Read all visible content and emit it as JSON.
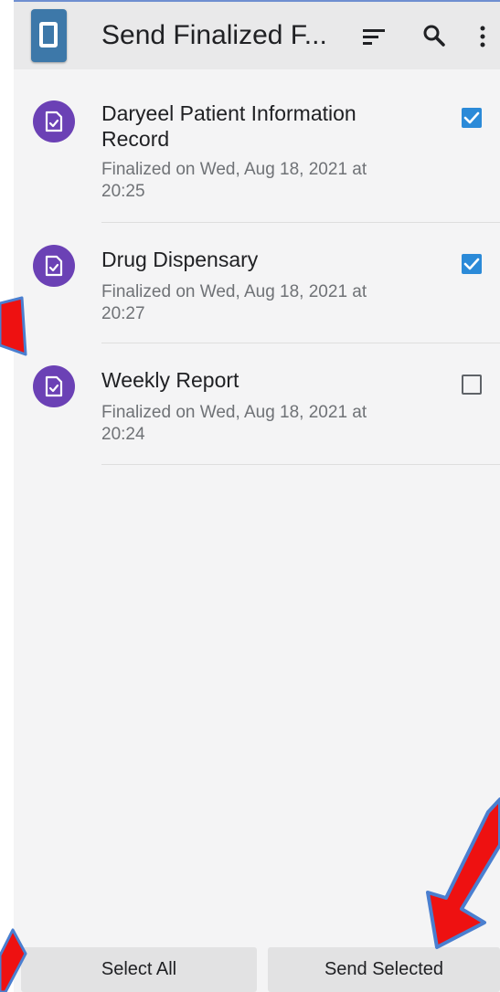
{
  "toolbar": {
    "title": "Send Finalized F...",
    "icons": [
      "app-logo-icon",
      "sort-icon",
      "search-icon",
      "more-vert-icon"
    ]
  },
  "forms": [
    {
      "title": "Daryeel Patient Information Record",
      "subtitle": "Finalized on Wed, Aug 18, 2021 at 20:25",
      "checked": true
    },
    {
      "title": "Drug Dispensary",
      "subtitle": "Finalized on Wed, Aug 18, 2021 at 20:27",
      "checked": true
    },
    {
      "title": "Weekly Report",
      "subtitle": "Finalized on Wed, Aug 18, 2021 at 20:24",
      "checked": false
    }
  ],
  "buttons": {
    "select_all": "Select All",
    "send_selected": "Send Selected"
  },
  "colors": {
    "avatar": "#6b41b5",
    "checkbox_checked": "#2b8ad8",
    "annotation_arrow": "#ee1111",
    "annotation_outline": "#4a7fd0"
  }
}
